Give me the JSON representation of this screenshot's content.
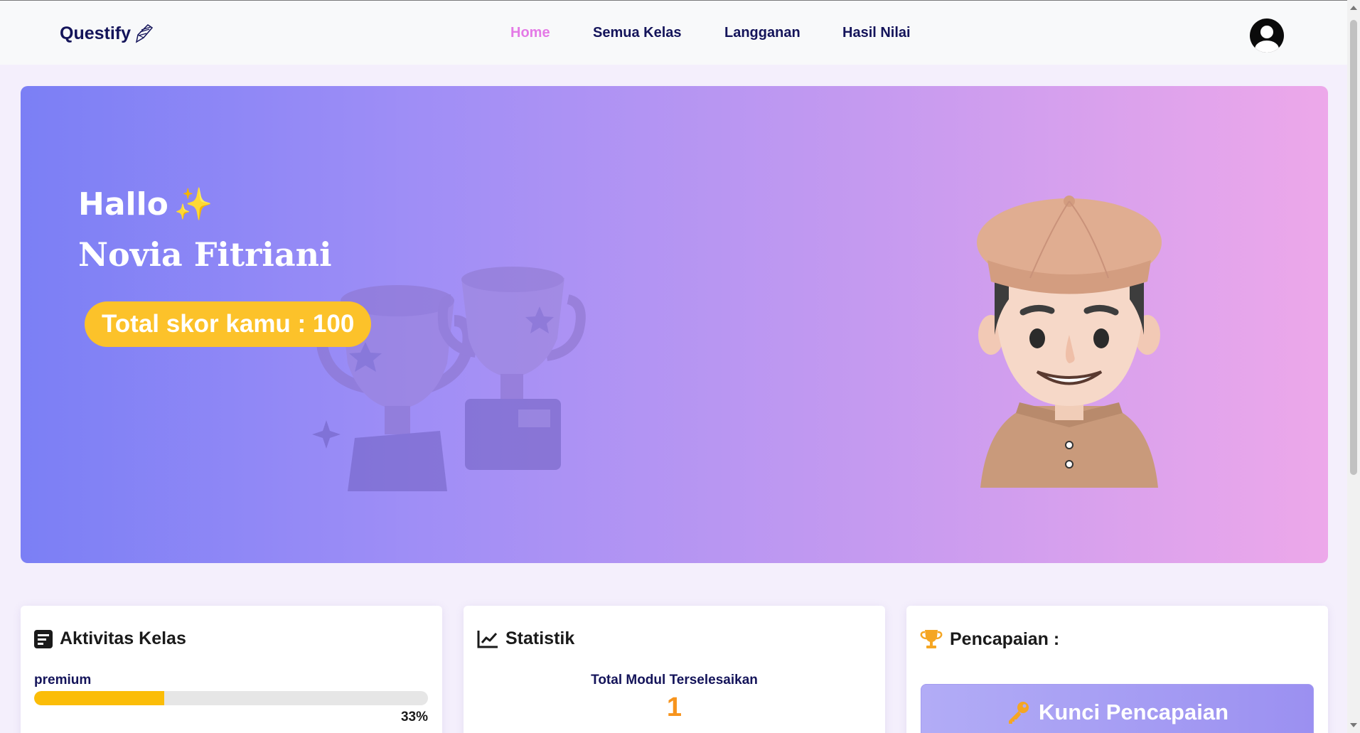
{
  "nav": {
    "logo": "Questify",
    "links": [
      {
        "label": "Home",
        "active": true
      },
      {
        "label": "Semua Kelas",
        "active": false
      },
      {
        "label": "Langganan",
        "active": false
      },
      {
        "label": "Hasil Nilai",
        "active": false
      }
    ],
    "avatar_icon": "user-circle-icon"
  },
  "hero": {
    "greeting": "Hallo",
    "greeting_emoji": "✨",
    "name": "Novia Fitriani",
    "score_text": "Total skor kamu : 100"
  },
  "cards": {
    "activity": {
      "title": "Aktivitas Kelas",
      "icon": "list-icon",
      "item_label": "premium",
      "progress_percent": 33,
      "progress_text": "33%"
    },
    "statistics": {
      "title": "Statistik",
      "icon": "line-chart-icon",
      "label": "Total Modul Terselesaikan",
      "value": "1"
    },
    "achievements": {
      "title": "Pencapaian :",
      "icon": "trophy-icon",
      "button_label": "Kunci Pencapaian",
      "button_icon": "key-icon"
    }
  },
  "colors": {
    "nav_active": "#e47ae6",
    "nav_text": "#14145a",
    "score_pill": "#fcc22a",
    "progress": "#fbbd08",
    "stat_value": "#f7941d"
  }
}
